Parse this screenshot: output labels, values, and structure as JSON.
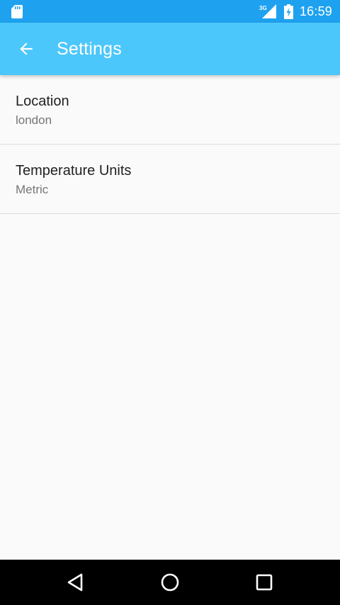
{
  "status_bar": {
    "time": "16:59",
    "network_label": "3G",
    "icons": [
      "sd-card-icon",
      "signal-3g-icon",
      "battery-charging-icon"
    ]
  },
  "toolbar": {
    "title": "Settings",
    "back_icon": "arrow-back-icon"
  },
  "settings": [
    {
      "title": "Location",
      "summary": "london"
    },
    {
      "title": "Temperature Units",
      "summary": "Metric"
    }
  ],
  "nav_bar": {
    "icons": [
      "back-triangle-icon",
      "home-circle-icon",
      "recents-square-icon"
    ]
  },
  "colors": {
    "status_bar": "#1ea2f0",
    "toolbar": "#4cc7fb",
    "background": "#fafafa",
    "divider": "#dcdcdc",
    "primary_text": "#212121",
    "secondary_text": "#757575"
  }
}
